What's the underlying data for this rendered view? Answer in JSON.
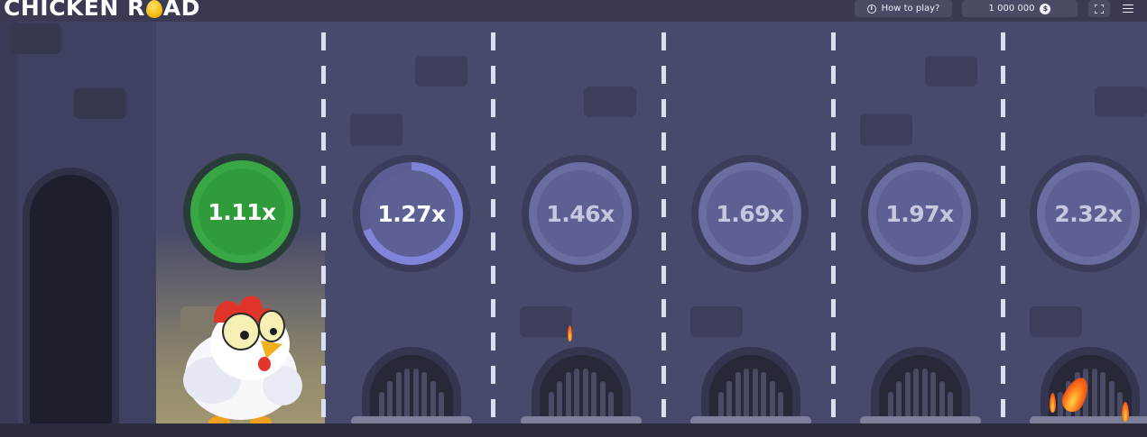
{
  "header": {
    "logo_left": "CHICKEN R",
    "logo_right": "AD",
    "how_to_play": "How to play?",
    "info_symbol": "i",
    "balance": "1 000 000",
    "currency_symbol": "$"
  },
  "multipliers": [
    {
      "label": "1.11x",
      "state": "active"
    },
    {
      "label": "1.27x",
      "state": "next"
    },
    {
      "label": "1.46x",
      "state": "locked"
    },
    {
      "label": "1.69x",
      "state": "locked"
    },
    {
      "label": "1.97x",
      "state": "locked"
    },
    {
      "label": "2.32x",
      "state": "locked"
    }
  ],
  "colors": {
    "active_coin": "#2f9b3a",
    "next_coin_ring": "#7f84da",
    "locked_coin": "#5d6092",
    "background": "#474a6a"
  }
}
